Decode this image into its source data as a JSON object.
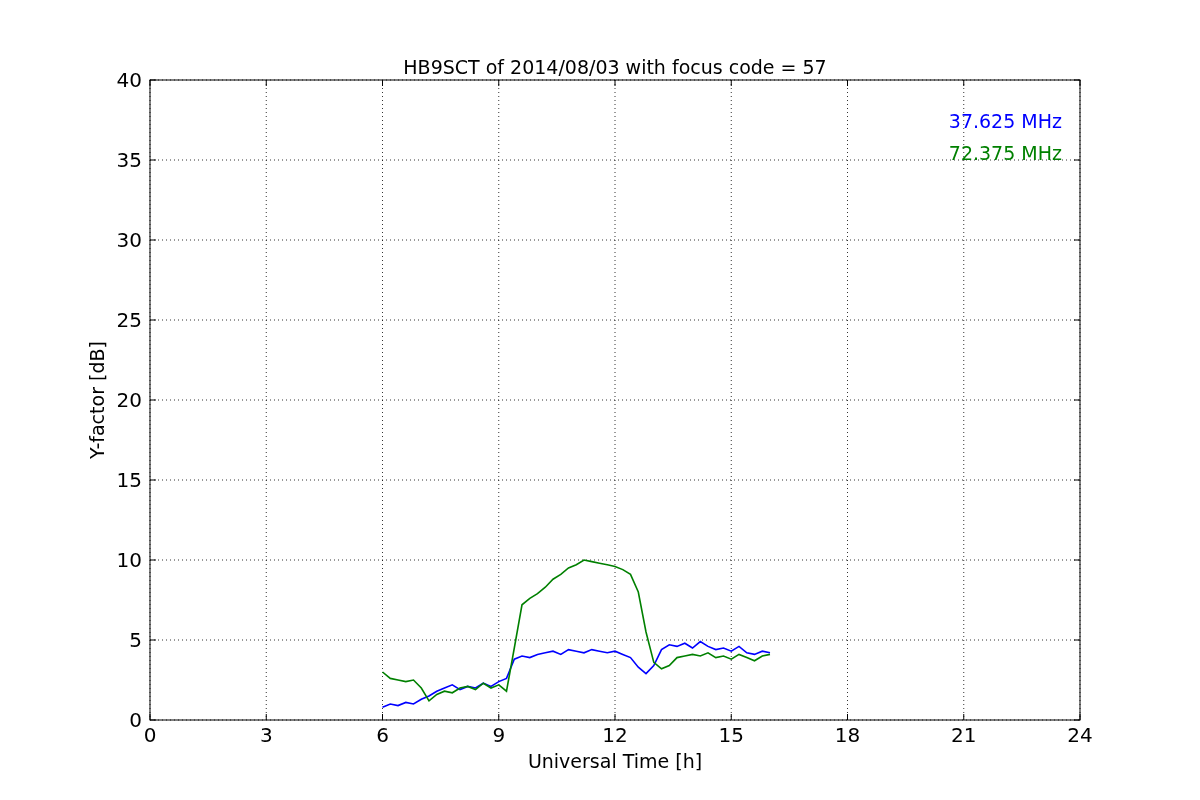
{
  "chart_data": {
    "type": "line",
    "title": "HB9SCT of 2014/08/03 with focus code = 57",
    "xlabel": "Universal Time [h]",
    "ylabel": "Y-factor [dB]",
    "x": [
      6.0,
      6.2,
      6.4,
      6.6,
      6.8,
      7.0,
      7.2,
      7.4,
      7.6,
      7.8,
      8.0,
      8.2,
      8.4,
      8.6,
      8.8,
      9.0,
      9.2,
      9.4,
      9.6,
      9.8,
      10.0,
      10.2,
      10.4,
      10.6,
      10.8,
      11.0,
      11.2,
      11.4,
      11.6,
      11.8,
      12.0,
      12.2,
      12.4,
      12.6,
      12.8,
      13.0,
      13.2,
      13.4,
      13.6,
      13.8,
      14.0,
      14.2,
      14.4,
      14.6,
      14.8,
      15.0,
      15.2,
      15.4,
      15.6,
      15.8,
      16.0
    ],
    "series": [
      {
        "name": "37.625 MHz",
        "color": "#0000ff",
        "values": [
          0.8,
          1.0,
          0.9,
          1.1,
          1.0,
          1.3,
          1.5,
          1.8,
          2.0,
          2.2,
          1.9,
          2.1,
          2.0,
          2.3,
          2.1,
          2.4,
          2.6,
          3.8,
          4.0,
          3.9,
          4.1,
          4.2,
          4.3,
          4.1,
          4.4,
          4.3,
          4.2,
          4.4,
          4.3,
          4.2,
          4.3,
          4.1,
          3.9,
          3.3,
          2.9,
          3.4,
          4.4,
          4.7,
          4.6,
          4.8,
          4.5,
          4.9,
          4.6,
          4.4,
          4.5,
          4.3,
          4.6,
          4.2,
          4.1,
          4.3,
          4.2
        ]
      },
      {
        "name": "72.375 MHz",
        "color": "#008000",
        "values": [
          3.0,
          2.6,
          2.5,
          2.4,
          2.5,
          2.0,
          1.2,
          1.6,
          1.8,
          1.7,
          2.0,
          2.1,
          1.9,
          2.3,
          2.0,
          2.2,
          1.8,
          4.5,
          7.2,
          7.6,
          7.9,
          8.3,
          8.8,
          9.1,
          9.5,
          9.7,
          10.0,
          9.9,
          9.8,
          9.7,
          9.6,
          9.4,
          9.1,
          8.0,
          5.5,
          3.6,
          3.2,
          3.4,
          3.9,
          4.0,
          4.1,
          4.0,
          4.2,
          3.9,
          4.0,
          3.8,
          4.1,
          3.9,
          3.7,
          4.0,
          4.1
        ]
      }
    ],
    "xlim": [
      0,
      24
    ],
    "ylim": [
      0,
      40
    ],
    "xticks": [
      0,
      3,
      6,
      9,
      12,
      15,
      18,
      21,
      24
    ],
    "yticks": [
      0,
      5,
      10,
      15,
      20,
      25,
      30,
      35,
      40
    ],
    "grid": true
  }
}
